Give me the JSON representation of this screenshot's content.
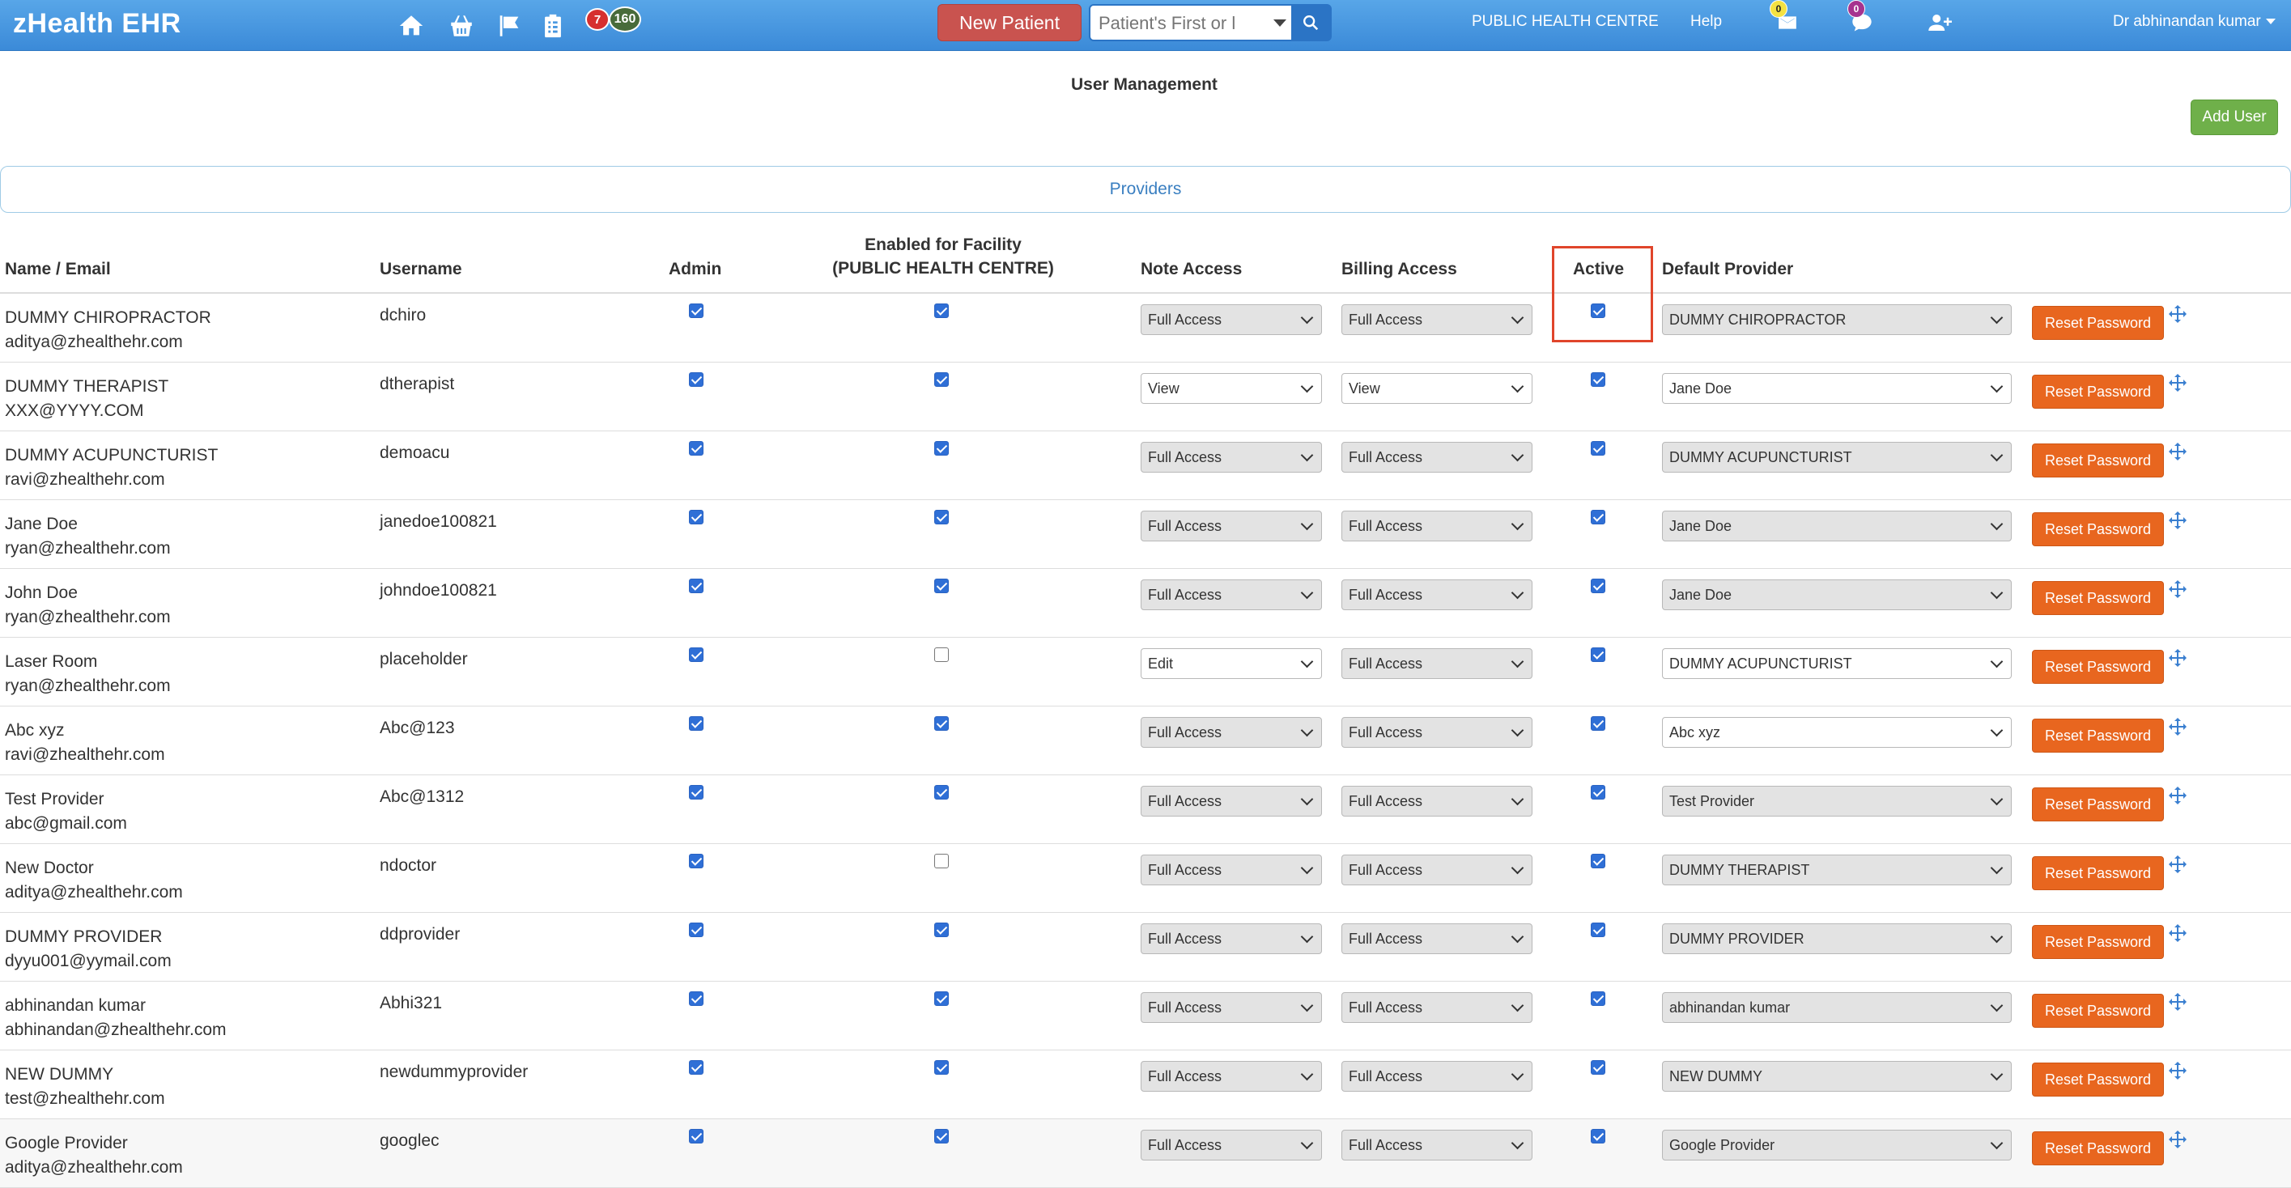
{
  "nav": {
    "brand": "zHealth EHR",
    "icons": [
      "home-icon",
      "basket-icon",
      "flag-icon",
      "clipboard-icon"
    ],
    "badge_red": "7",
    "badge_green": "160",
    "new_patient_label": "New Patient",
    "search_placeholder": "Patient's First or l",
    "facility_label": "PUBLIC HEALTH CENTRE",
    "help_label": "Help",
    "mail_count": "0",
    "chat_count": "0",
    "user_label": "Dr abhinandan kumar"
  },
  "page": {
    "title": "User Management",
    "add_user_label": "Add User",
    "section_label": "Providers"
  },
  "table": {
    "headers": {
      "name": "Name / Email",
      "username": "Username",
      "admin": "Admin",
      "enabled_line1": "Enabled for Facility",
      "enabled_line2": "(PUBLIC HEALTH CENTRE)",
      "note": "Note Access",
      "billing": "Billing Access",
      "active": "Active",
      "default_provider": "Default Provider"
    },
    "reset_label": "Reset Password",
    "rows": [
      {
        "name": "DUMMY CHIROPRACTOR",
        "email": "aditya@zhealthehr.com",
        "username": "dchiro",
        "admin": true,
        "enabled": true,
        "note": "Full Access",
        "billing": "Full Access",
        "active": true,
        "provider": "DUMMY CHIROPRACTOR"
      },
      {
        "name": "DUMMY THERAPIST",
        "email": "XXX@YYYY.COM",
        "username": "dtherapist",
        "admin": true,
        "enabled": true,
        "note": "View",
        "billing": "View",
        "active": true,
        "provider": "Jane Doe"
      },
      {
        "name": "DUMMY ACUPUNCTURIST",
        "email": "ravi@zhealthehr.com",
        "username": "demoacu",
        "admin": true,
        "enabled": true,
        "note": "Full Access",
        "billing": "Full Access",
        "active": true,
        "provider": "DUMMY ACUPUNCTURIST"
      },
      {
        "name": "Jane Doe",
        "email": "ryan@zhealthehr.com",
        "username": "janedoe100821",
        "admin": true,
        "enabled": true,
        "note": "Full Access",
        "billing": "Full Access",
        "active": true,
        "provider": "Jane Doe"
      },
      {
        "name": "John Doe",
        "email": "ryan@zhealthehr.com",
        "username": "johndoe100821",
        "admin": true,
        "enabled": true,
        "note": "Full Access",
        "billing": "Full Access",
        "active": true,
        "provider": "Jane Doe"
      },
      {
        "name": "Laser Room",
        "email": "ryan@zhealthehr.com",
        "username": "placeholder",
        "admin": true,
        "enabled": false,
        "note": "Edit",
        "billing": "Full Access",
        "active": true,
        "provider": "DUMMY ACUPUNCTURIST"
      },
      {
        "name": "Abc xyz",
        "email": "ravi@zhealthehr.com",
        "username": "Abc@123",
        "admin": true,
        "enabled": true,
        "note": "Full Access",
        "billing": "Full Access",
        "active": true,
        "provider": "Abc xyz"
      },
      {
        "name": "Test Provider",
        "email": "abc@gmail.com",
        "username": "Abc@1312",
        "admin": true,
        "enabled": true,
        "note": "Full Access",
        "billing": "Full Access",
        "active": true,
        "provider": "Test Provider"
      },
      {
        "name": "New Doctor",
        "email": "aditya@zhealthehr.com",
        "username": "ndoctor",
        "admin": true,
        "enabled": false,
        "note": "Full Access",
        "billing": "Full Access",
        "active": true,
        "provider": "DUMMY THERAPIST"
      },
      {
        "name": "DUMMY PROVIDER",
        "email": "dyyu001@yymail.com",
        "username": "ddprovider",
        "admin": true,
        "enabled": true,
        "note": "Full Access",
        "billing": "Full Access",
        "active": true,
        "provider": "DUMMY PROVIDER"
      },
      {
        "name": "abhinandan kumar",
        "email": "abhinandan@zhealthehr.com",
        "username": "Abhi321",
        "admin": true,
        "enabled": true,
        "note": "Full Access",
        "billing": "Full Access",
        "active": true,
        "provider": "abhinandan kumar"
      },
      {
        "name": "NEW DUMMY",
        "email": "test@zhealthehr.com",
        "username": "newdummyprovider",
        "admin": true,
        "enabled": true,
        "note": "Full Access",
        "billing": "Full Access",
        "active": true,
        "provider": "NEW DUMMY"
      },
      {
        "name": "Google Provider",
        "email": "aditya@zhealthehr.com",
        "username": "googlec",
        "admin": true,
        "enabled": true,
        "note": "Full Access",
        "billing": "Full Access",
        "active": true,
        "provider": "Google Provider"
      }
    ]
  }
}
